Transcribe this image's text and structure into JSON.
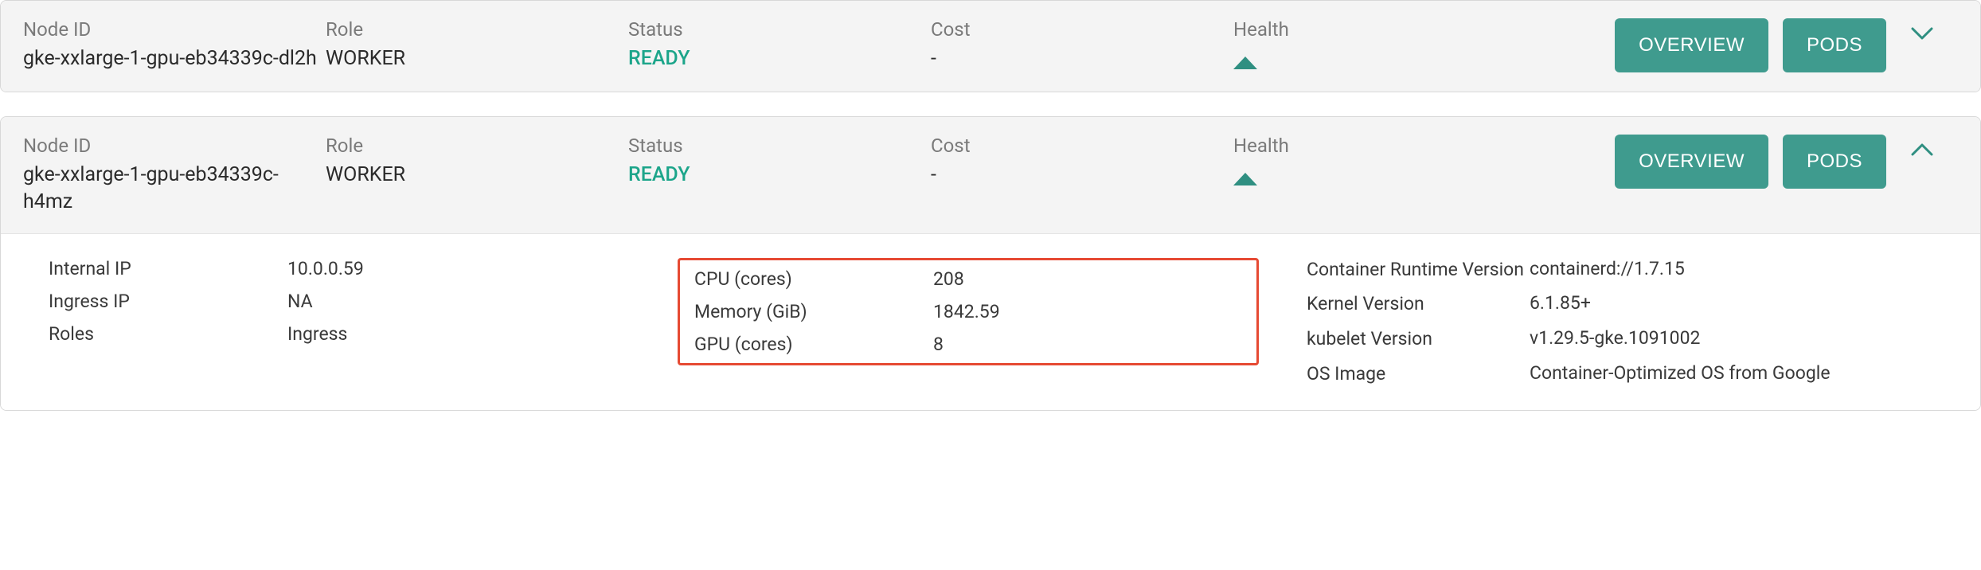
{
  "labels": {
    "node_id": "Node ID",
    "role": "Role",
    "status": "Status",
    "cost": "Cost",
    "health": "Health"
  },
  "buttons": {
    "overview": "OVERVIEW",
    "pods": "PODS"
  },
  "icons": {
    "health_up": "health-up-icon",
    "chevron_down": "chevron-down-icon",
    "chevron_up": "chevron-up-icon"
  },
  "colors": {
    "brand_button": "#3f9b8e",
    "status_ready": "#1ca58a",
    "health_triangle": "#2f8f81",
    "highlight_border": "#e64a33"
  },
  "nodes": [
    {
      "id": "gke-xxlarge-1-gpu-eb34339c-dl2h",
      "role": "WORKER",
      "status": "READY",
      "cost": "-",
      "expanded": false
    },
    {
      "id": "gke-xxlarge-1-gpu-eb34339c-h4mz",
      "role": "WORKER",
      "status": "READY",
      "cost": "-",
      "expanded": true,
      "details": {
        "internal_ip_label": "Internal IP",
        "internal_ip": "10.0.0.59",
        "ingress_ip_label": "Ingress IP",
        "ingress_ip": "NA",
        "roles_label": "Roles",
        "roles": "Ingress",
        "cpu_label": "CPU (cores)",
        "cpu": "208",
        "memory_label": "Memory (GiB)",
        "memory": "1842.59",
        "gpu_label": "GPU (cores)",
        "gpu": "8",
        "container_runtime_label": "Container Runtime Version",
        "container_runtime": "containerd://1.7.15",
        "kernel_label": "Kernel Version",
        "kernel": "6.1.85+",
        "kubelet_label": "kubelet Version",
        "kubelet": "v1.29.5-gke.1091002",
        "os_label": "OS Image",
        "os": "Container-Optimized OS from Google"
      }
    }
  ]
}
